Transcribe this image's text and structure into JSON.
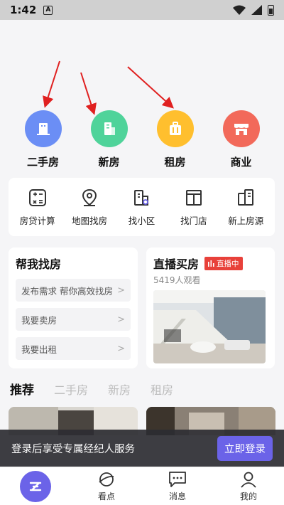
{
  "status_bar": {
    "time": "1:42",
    "notification_icon": "A"
  },
  "categories": [
    {
      "label": "二手房",
      "icon": "building-icon",
      "color": "#6b8ef5"
    },
    {
      "label": "新房",
      "icon": "new-building-icon",
      "color": "#4fd39a"
    },
    {
      "label": "租房",
      "icon": "suitcase-icon",
      "color": "#ffbf2e"
    },
    {
      "label": "商业",
      "icon": "shop-icon",
      "color": "#f2695a"
    }
  ],
  "tools": [
    {
      "label": "房贷计算",
      "icon": "calculator-icon"
    },
    {
      "label": "地图找房",
      "icon": "map-pin-icon"
    },
    {
      "label": "找小区",
      "icon": "community-icon"
    },
    {
      "label": "找门店",
      "icon": "store-icon"
    },
    {
      "label": "新上房源",
      "icon": "new-listing-icon"
    }
  ],
  "help_card": {
    "title": "帮我找房",
    "items": [
      "发布需求 帮你高效找房",
      "我要卖房",
      "我要出租"
    ]
  },
  "live_card": {
    "title": "直播买房",
    "badge": "直播中",
    "viewers": "5419人观看"
  },
  "tabs": [
    "推荐",
    "二手房",
    "新房",
    "租房"
  ],
  "login_bar": {
    "text": "登录后享受专属经纪人服务",
    "button": "立即登录"
  },
  "bottom_nav": [
    {
      "label": "",
      "icon": "home-logo-icon"
    },
    {
      "label": "看点",
      "icon": "planet-icon"
    },
    {
      "label": "消息",
      "icon": "message-icon"
    },
    {
      "label": "我的",
      "icon": "user-icon"
    }
  ]
}
